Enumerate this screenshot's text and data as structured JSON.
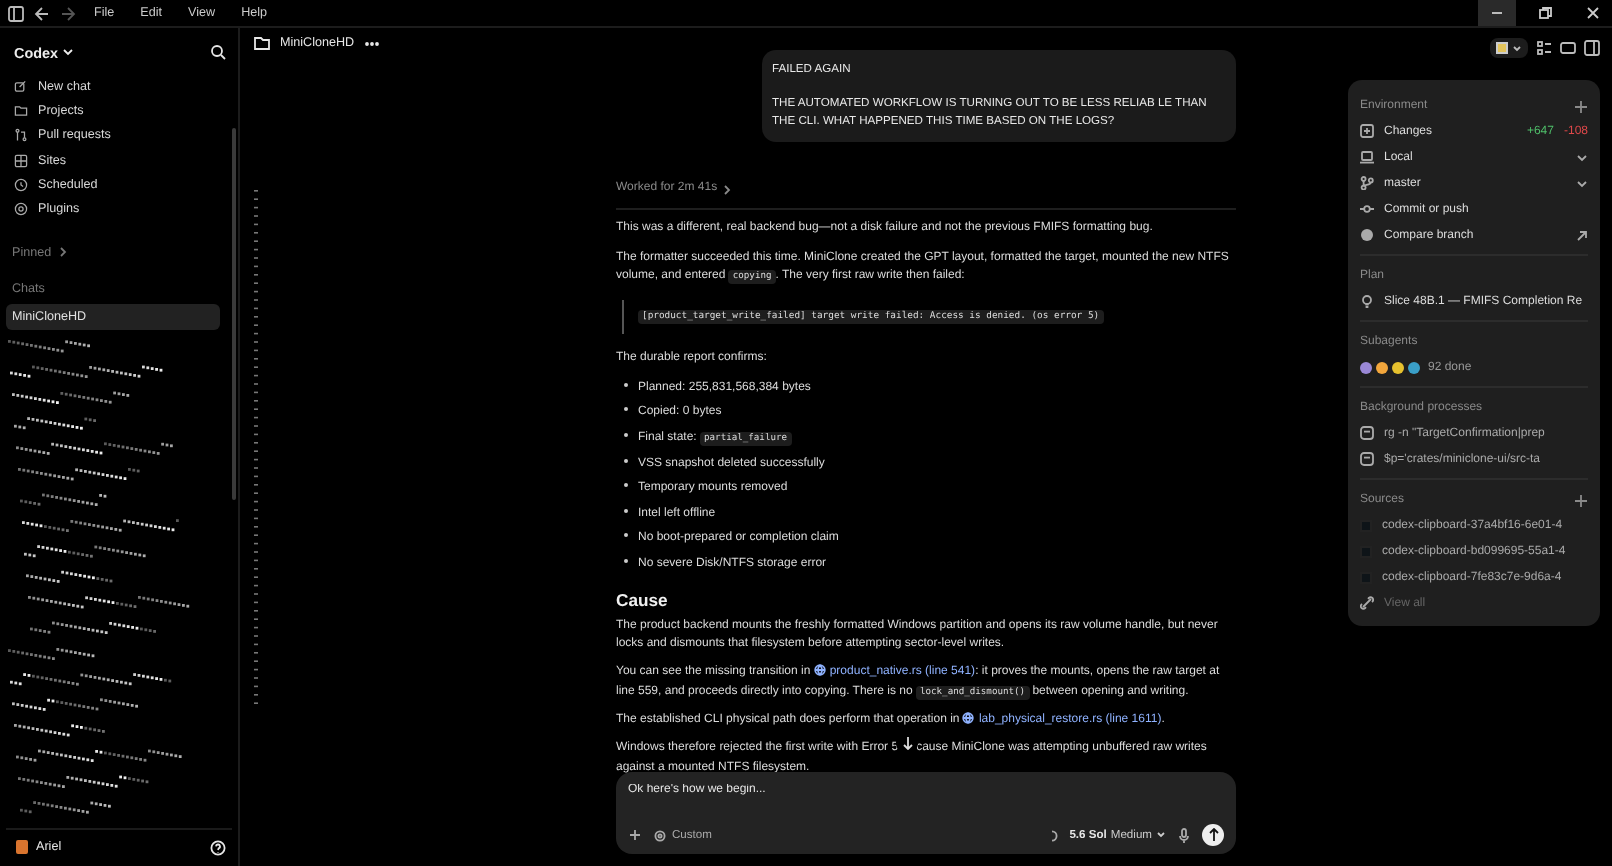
{
  "menu": {
    "items": [
      "File",
      "Edit",
      "View",
      "Help"
    ]
  },
  "sidebar": {
    "app_name": "Codex",
    "nav": [
      {
        "kind": "new",
        "label": "New chat"
      },
      {
        "kind": "projects",
        "label": "Projects"
      },
      {
        "kind": "pull",
        "label": "Pull requests"
      },
      {
        "kind": "sites",
        "label": "Sites"
      },
      {
        "kind": "scheduled",
        "label": "Scheduled"
      },
      {
        "kind": "plugins",
        "label": "Plugins"
      }
    ],
    "pinned": "Pinned",
    "chats_heading": "Chats",
    "chats": [
      {
        "label": "MiniCloneHD",
        "selected": true
      }
    ],
    "user": "Ariel"
  },
  "header": {
    "title": "MiniCloneHD"
  },
  "user_message": {
    "paragraphs": [
      "FAILED AGAIN",
      "THE AUTOMATED WORKFLOW IS TURNING OUT TO BE LESS RELIAB LE THAN THE CLI. WHAT HAPPENED THIS TIME BASED ON THE LOGS?"
    ]
  },
  "worked_for": "Worked for 2m 41s",
  "response": [
    {
      "kind": "paragraph",
      "parts": [
        {
          "kind": "text",
          "text": "This was a different, real backend bug—not a disk failure and not the previous FMIFS formatting bug."
        }
      ]
    },
    {
      "kind": "paragraph",
      "parts": [
        {
          "kind": "text",
          "text": "The formatter succeeded this time. MiniClone created the GPT layout, formatted the target, mounted the new NTFS volume, and entered "
        },
        {
          "kind": "code",
          "text": "copying"
        },
        {
          "kind": "text",
          "text": ". The very first raw write then failed:"
        }
      ]
    },
    {
      "kind": "quote_code",
      "text": "[product_target_write_failed] target write failed: Access is denied. (os error 5)"
    },
    {
      "kind": "paragraph",
      "parts": [
        {
          "kind": "text",
          "text": "The durable report confirms:"
        }
      ]
    },
    {
      "kind": "list",
      "items": [
        {
          "parts": [
            {
              "kind": "text",
              "text": "Planned: 255,831,568,384 bytes"
            }
          ]
        },
        {
          "parts": [
            {
              "kind": "text",
              "text": "Copied: 0 bytes"
            }
          ]
        },
        {
          "parts": [
            {
              "kind": "text",
              "text": "Final state: "
            },
            {
              "kind": "code",
              "text": "partial_failure"
            }
          ]
        },
        {
          "parts": [
            {
              "kind": "text",
              "text": "VSS snapshot deleted successfully"
            }
          ]
        },
        {
          "parts": [
            {
              "kind": "text",
              "text": "Temporary mounts removed"
            }
          ]
        },
        {
          "parts": [
            {
              "kind": "text",
              "text": "Intel left offline"
            }
          ]
        },
        {
          "parts": [
            {
              "kind": "text",
              "text": "No boot-prepared or completion claim"
            }
          ]
        },
        {
          "parts": [
            {
              "kind": "text",
              "text": "No severe Disk/NTFS storage error"
            }
          ]
        }
      ]
    },
    {
      "kind": "heading",
      "text": "Cause"
    },
    {
      "kind": "paragraph",
      "parts": [
        {
          "kind": "text",
          "text": "The product backend mounts the freshly formatted Windows partition and opens its raw volume handle, but never locks and dismounts that filesystem before attempting sector-level writes."
        }
      ]
    },
    {
      "kind": "paragraph",
      "parts": [
        {
          "kind": "text",
          "text": "You can see the missing transition in "
        },
        {
          "kind": "link",
          "text": "product_native.rs (line 541)"
        },
        {
          "kind": "text",
          "text": ": it proves the mounts, opens the raw target at line 559, and proceeds directly into copying. There is no "
        },
        {
          "kind": "code",
          "text": "lock_and_dismount()"
        },
        {
          "kind": "text",
          "text": " between opening and writing."
        }
      ]
    },
    {
      "kind": "paragraph",
      "parts": [
        {
          "kind": "text",
          "text": "The established CLI physical path does perform that operation in "
        },
        {
          "kind": "link",
          "text": "lab_physical_restore.rs (line 1611)"
        },
        {
          "kind": "text",
          "text": "."
        }
      ]
    },
    {
      "kind": "paragraph",
      "parts": [
        {
          "kind": "text",
          "text": "Windows therefore rejected the first write with Error 5"
        },
        {
          "kind": "scroll_button"
        },
        {
          "kind": "text",
          "text": "cause MiniClone was attempting unbuffered raw writes against a mounted NTFS filesystem."
        }
      ]
    }
  ],
  "composer": {
    "value": "Ok here's how we begin...",
    "mode": "Custom",
    "model": "5.6 Sol",
    "effort": "Medium"
  },
  "panel": {
    "sections": [
      {
        "title": "Environment",
        "add": true,
        "rows": [
          {
            "kind": "changes",
            "label": "Changes",
            "added": "+647",
            "removed": "-108"
          },
          {
            "kind": "local",
            "label": "Local"
          },
          {
            "kind": "branch",
            "label": "master"
          },
          {
            "kind": "commit",
            "label": "Commit or push"
          },
          {
            "kind": "compare",
            "label": "Compare branch"
          }
        ]
      },
      {
        "title": "Plan",
        "add": false,
        "rows": [
          {
            "kind": "plan",
            "label": "Slice 48B.1 — FMIFS Completion Re"
          }
        ]
      },
      {
        "title": "Subagents",
        "add": false,
        "rows": [
          {
            "kind": "agents",
            "label": "92 done",
            "agents": [
              {
                "color": "#9a88d6"
              },
              {
                "color": "#f2a63c"
              },
              {
                "color": "#e6c12e"
              },
              {
                "color": "#3a9fc8"
              }
            ]
          }
        ]
      },
      {
        "title": "Background processes",
        "add": false,
        "rows": [
          {
            "kind": "process",
            "label": "rg -n \"TargetConfirmation|prep"
          },
          {
            "kind": "process",
            "label": "$p='crates/miniclone-ui/src-ta"
          }
        ]
      },
      {
        "title": "Sources",
        "add": true,
        "rows": [
          {
            "kind": "source",
            "label": "codex-clipboard-37a4bf16-6e01-4"
          },
          {
            "kind": "source",
            "label": "codex-clipboard-bd099695-55a1-4"
          },
          {
            "kind": "source",
            "label": "codex-clipboard-7fe83c7e-9d6a-4"
          },
          {
            "kind": "view_all",
            "label": "View all"
          }
        ]
      }
    ]
  }
}
